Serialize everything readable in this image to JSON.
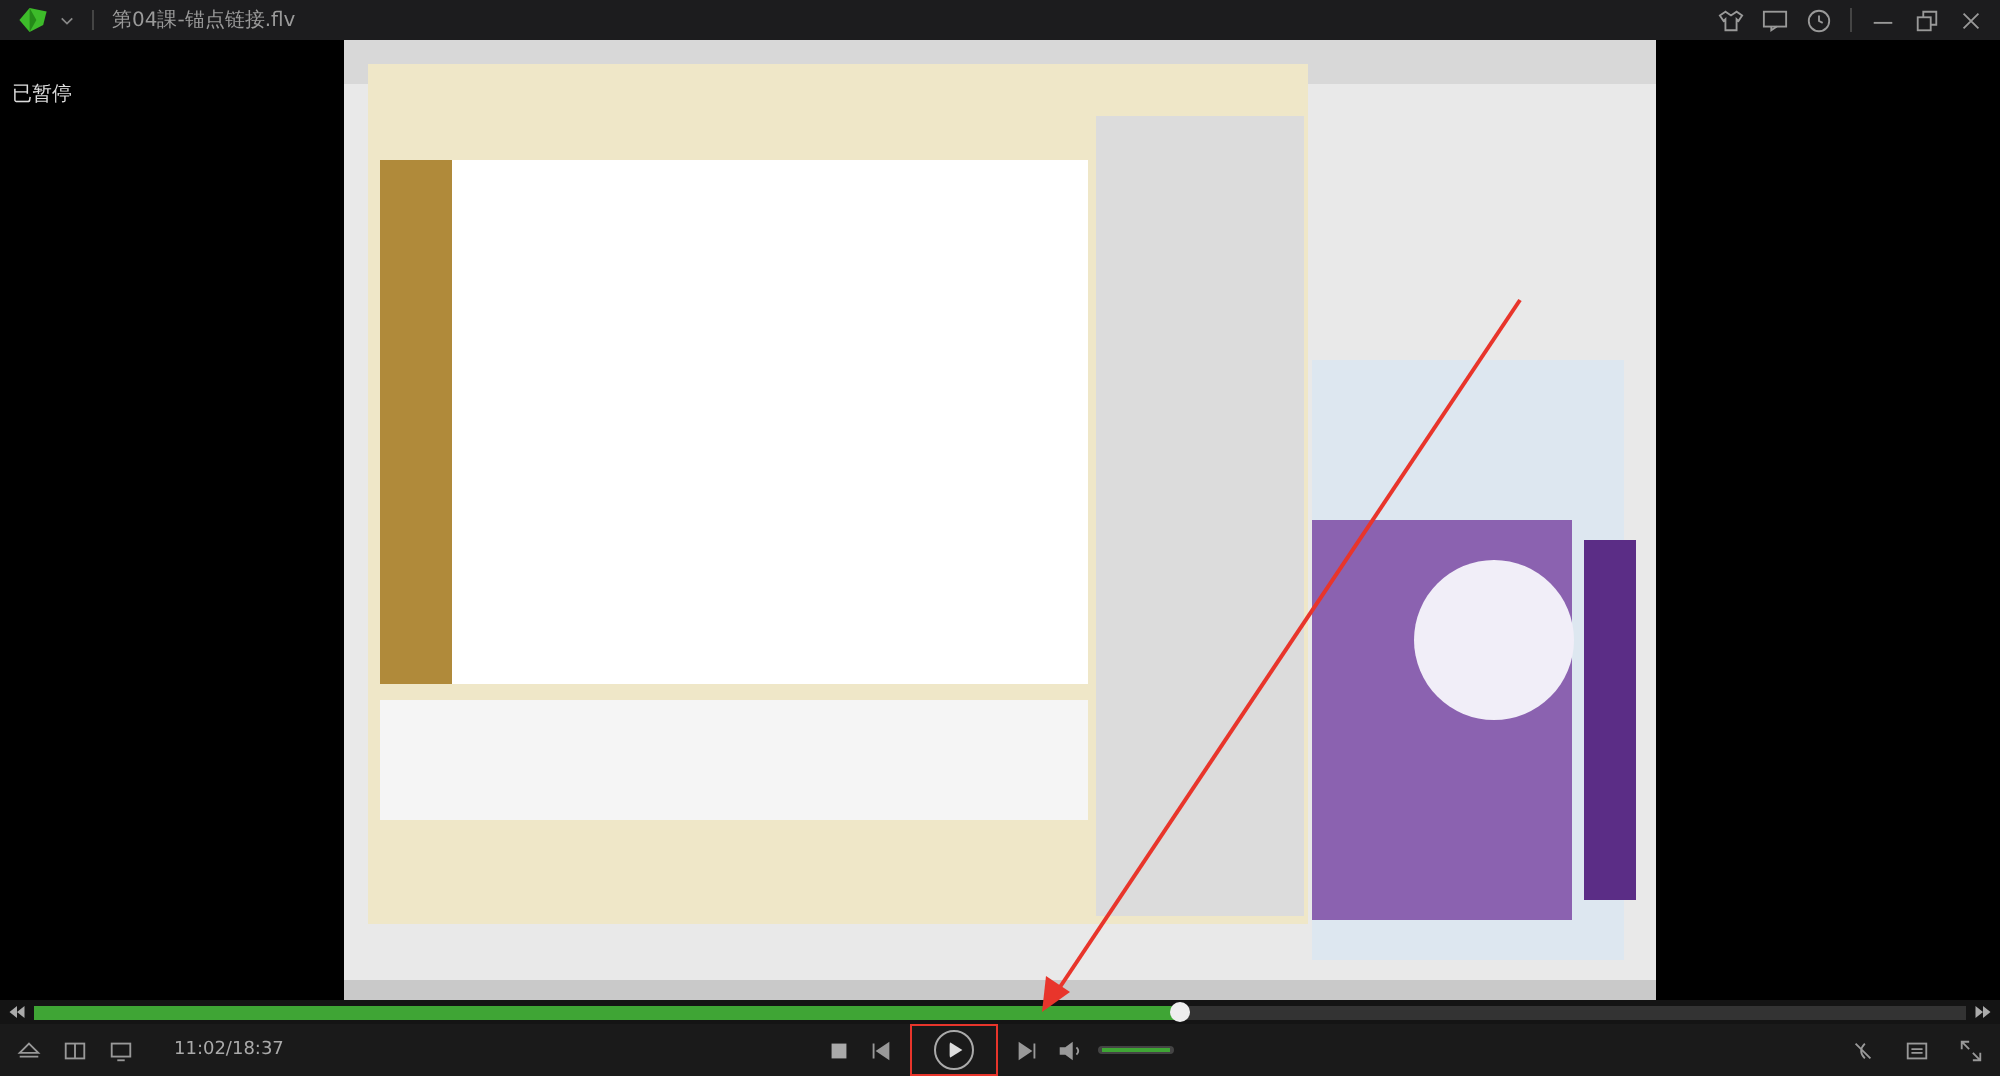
{
  "title_bar": {
    "title": "第04課-锚点链接.flv"
  },
  "video": {
    "kind": "picture",
    "status": "已暂停"
  },
  "progress": {
    "level": 0.593
  },
  "controls": {
    "time": "11:02/18:37",
    "playing": false,
    "volume": {
      "level": 1
    }
  },
  "annotations": {
    "highlight_play": true,
    "arrow": true
  }
}
